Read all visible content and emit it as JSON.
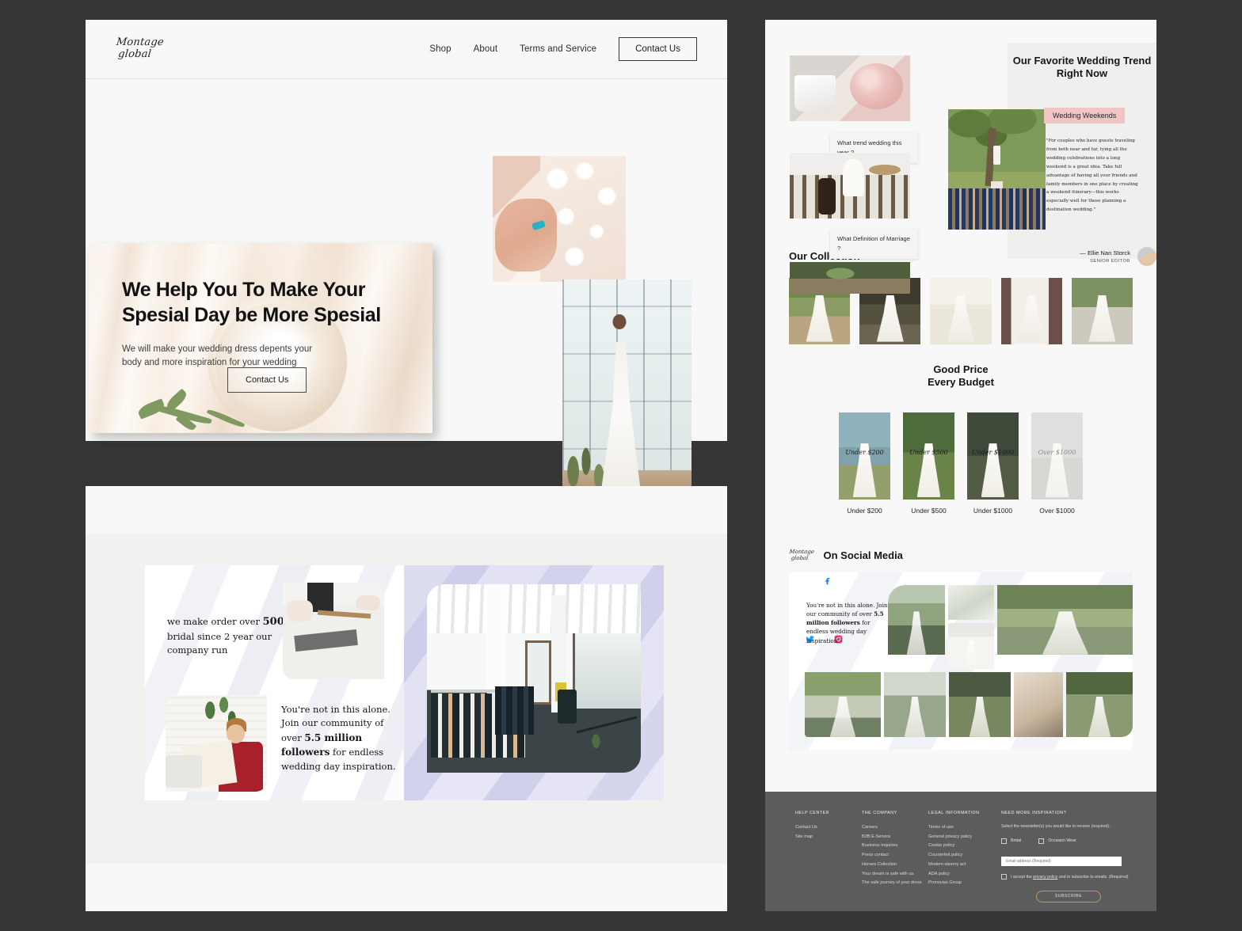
{
  "brand": {
    "line1": "Montage",
    "line2": "global"
  },
  "nav": {
    "links": [
      "Shop",
      "About",
      "Terms and Service"
    ],
    "cta": "Contact Us"
  },
  "hero": {
    "title": "We Help You To Make Your Spesial Day be More Spesial",
    "subtitle": "We will make your wedding dress depents your body and more inspiration for your wedding",
    "button": "Contact Us"
  },
  "story": {
    "block_a_pre": "we make order over ",
    "block_a_bold": "500",
    "block_a_post": " bridal since 2 year our company run",
    "block_b_pre": "You're not in this alone. Join our community of over ",
    "block_b_bold": "5.5 million followers",
    "block_b_post": " for endless wedding day inspiration."
  },
  "trend": {
    "caption_1": "What trend wedding this year ?",
    "caption_2": "What Definition of Marriage ?",
    "heading": "Our Favorite Wedding Trend Right Now",
    "badge": "Wedding Weekends",
    "badge_color": "#f0c5c4",
    "quote": "\"For couples who have guests traveling from both near and far, tying all the wedding celebrations into a long weekend is a great idea. Take full advantage of having all your friends and family members in one place by creating a weekend itinerary—this works especially well for those planning a destination wedding.\"",
    "author": "— Ellie Nan Storck",
    "author_role": "SENIOR EDITOR"
  },
  "collection": {
    "title": "Our  Collection"
  },
  "price": {
    "title_line1": "Good Price",
    "title_line2": "Every Budget",
    "items": [
      {
        "script": "Under $200",
        "label": "Under $200"
      },
      {
        "script": "Under $500",
        "label": "Under $500"
      },
      {
        "script": "Under $1000",
        "label": "Under $1000"
      },
      {
        "script": "Over $1000",
        "label": "Over $1000"
      }
    ]
  },
  "social": {
    "title": "On Social Media",
    "copy_pre": "You're not in this alone. Join our community of over ",
    "copy_bold": "5.5 million followers",
    "copy_post": " for endless wedding day inspiration.",
    "icons": [
      "facebook-icon",
      "twitter-icon",
      "instagram-icon"
    ]
  },
  "footer": {
    "columns": [
      {
        "head": "HELP CENTER",
        "links": [
          "Contact Us",
          "Site map"
        ]
      },
      {
        "head": "THE COMPANY",
        "links": [
          "Careers",
          "B2B E-Service",
          "Business Inquiries",
          "Press contact",
          "Heroes Collection",
          "Your dream is safe with us",
          "The safe journey of your dress"
        ]
      },
      {
        "head": "LEGAL INFORMATION",
        "links": [
          "Terms of use",
          "General privacy policy",
          "Cookie policy",
          "Counterfeit policy",
          "Modern slavery act",
          "ADA policy",
          "Pronovias Group"
        ]
      }
    ],
    "newsletter": {
      "head": "NEED MORE INSPIRATION?",
      "note": "Select the newsletter(s) you would like to receive (required):",
      "check1": "Bridal",
      "check2": "Occasion Wear",
      "email_placeholder": "Email address (Required)",
      "terms_pre": "I accept the ",
      "terms_link": "privacy policy",
      "terms_post": " and to subscribe to emails. (Required)",
      "button": "SUBSCRIBE",
      "button_border": "#b79a63"
    }
  }
}
